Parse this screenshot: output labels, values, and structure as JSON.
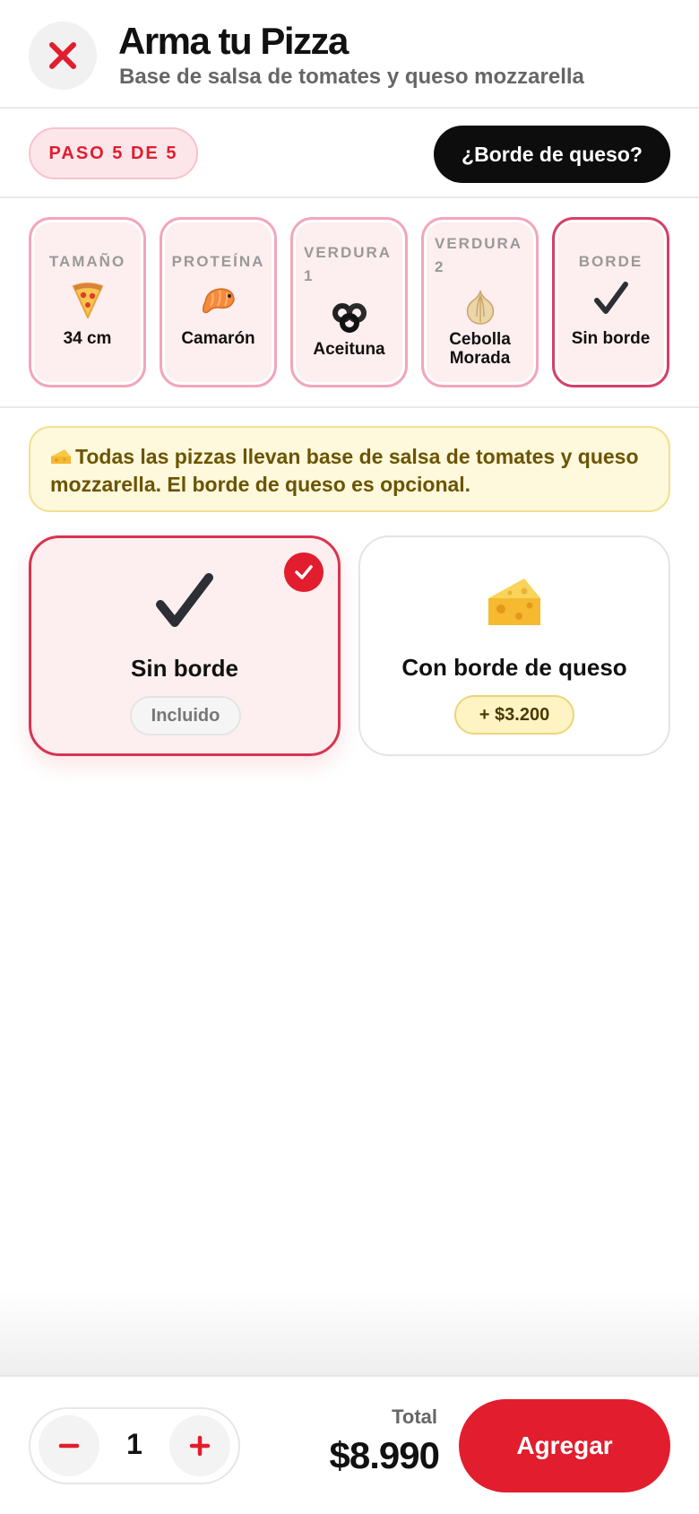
{
  "header": {
    "title": "Arma tu Pizza",
    "subtitle": "Base de salsa de tomates y queso mozzarella"
  },
  "steps": {
    "badge": "PASO 5 DE 5",
    "question": "¿Borde de queso?"
  },
  "summary": [
    {
      "label": "TAMAÑO",
      "value": "34 cm",
      "icon": "pizza-icon"
    },
    {
      "label": "PROTEÍNA",
      "value": "Camarón",
      "icon": "shrimp-icon"
    },
    {
      "label": "VERDURA 1",
      "value": "Aceituna",
      "icon": "olive-icon"
    },
    {
      "label": "VERDURA 2",
      "value": "Cebolla Morada",
      "icon": "onion-icon"
    },
    {
      "label": "BORDE",
      "value": "Sin borde",
      "icon": "check-icon"
    }
  ],
  "note": {
    "icon": "cheese-icon",
    "text": "Todas las pizzas llevan base de salsa de tomates y queso mozzarella. El borde de queso es opcional."
  },
  "options": [
    {
      "title": "Sin borde",
      "price": "Incluido",
      "selected": true,
      "icon": "check-icon"
    },
    {
      "title": "Con borde de queso",
      "price": "+ $3.200",
      "selected": false,
      "icon": "cheese-icon"
    }
  ],
  "footer": {
    "quantity": "1",
    "minus": "−",
    "plus": "+",
    "total_label": "Total",
    "total_value": "$8.990",
    "add_label": "Agregar"
  },
  "colors": {
    "accent": "#e11d2e",
    "card_bg": "#fdeef0",
    "note_bg": "#fef8dc"
  }
}
